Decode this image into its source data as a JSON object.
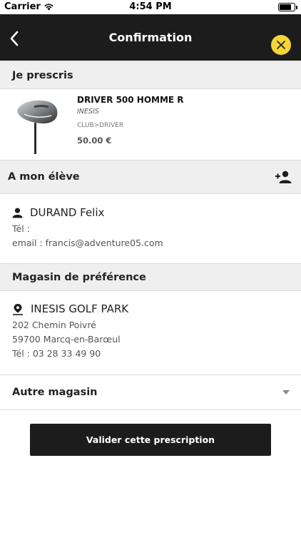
{
  "status_bar": {
    "carrier": "Carrier",
    "time": "4:54 PM"
  },
  "nav": {
    "title": "Confirmation",
    "back_icon": "chevron-left-icon",
    "close_icon": "close-icon"
  },
  "colors": {
    "nav_bg": "#1c1c1c",
    "accent": "#f4d437",
    "section_bg": "#efefef"
  },
  "prescribe": {
    "heading": "Je prescris",
    "product": {
      "name": "DRIVER 500 HOMME R",
      "brand": "INESIS",
      "category": "CLUB>DRIVER",
      "price": "50.00 €"
    }
  },
  "student": {
    "heading": "A mon élève",
    "name": "DURAND Felix",
    "phone": "Tél :",
    "email": "email : francis@adventure05.com"
  },
  "store": {
    "heading": "Magasin de préférence",
    "name": "INESIS GOLF PARK",
    "street": "202 Chemin Poivré",
    "city": "59700 Marcq-en-Barœul",
    "phone": "Tél : 03 28 33 49 90"
  },
  "other_store": {
    "label": "Autre magasin"
  },
  "submit": {
    "label": "Valider cette prescription"
  }
}
